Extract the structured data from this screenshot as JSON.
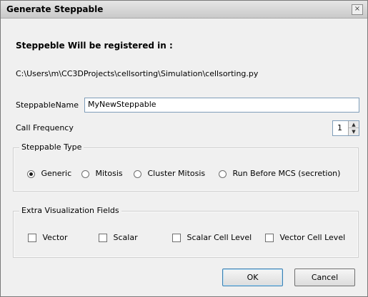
{
  "dialog": {
    "title": "Generate Steppable",
    "close_glyph": "×"
  },
  "registration": {
    "heading": "Steppeble Will be registered in :",
    "path": "C:\\Users\\m\\CC3DProjects\\cellsorting\\Simulation\\cellsorting.py"
  },
  "form": {
    "name_label": "SteppableName",
    "name_value": "MyNewSteppable",
    "frequency_label": "Call Frequency",
    "frequency_value": "1"
  },
  "steppable_type": {
    "legend": "Steppable Type",
    "selected": "Generic",
    "options": [
      "Generic",
      "Mitosis",
      "Cluster Mitosis",
      "Run Before MCS (secretion)"
    ]
  },
  "extra_fields": {
    "legend": "Extra Visualization Fields",
    "options": [
      {
        "label": "Vector",
        "checked": false
      },
      {
        "label": "Scalar",
        "checked": false
      },
      {
        "label": "Scalar Cell Level",
        "checked": false
      },
      {
        "label": "Vector Cell Level",
        "checked": false
      }
    ]
  },
  "buttons": {
    "ok": "OK",
    "cancel": "Cancel"
  }
}
